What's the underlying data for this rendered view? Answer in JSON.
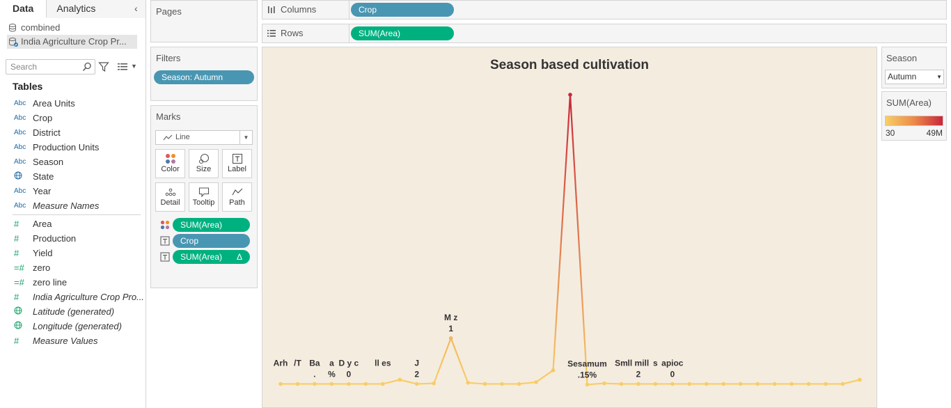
{
  "data_pane": {
    "tabs": [
      {
        "label": "Data",
        "active": true
      },
      {
        "label": "Analytics",
        "active": false
      }
    ],
    "collapse_glyph": "‹",
    "datasources": [
      {
        "label": "combined",
        "icon": "datasource-icon",
        "selected": false
      },
      {
        "label": "India Agriculture Crop Pr...",
        "icon": "datasource-linked-icon",
        "selected": true
      }
    ],
    "search": {
      "placeholder": "Search"
    },
    "tables_heading": "Tables",
    "dimensions": [
      {
        "type": "Abc",
        "label": "Area Units",
        "italic": false
      },
      {
        "type": "Abc",
        "label": "Crop",
        "italic": false
      },
      {
        "type": "Abc",
        "label": "District",
        "italic": false
      },
      {
        "type": "Abc",
        "label": "Production Units",
        "italic": false
      },
      {
        "type": "Abc",
        "label": "Season",
        "italic": false
      },
      {
        "type": "geo",
        "label": "State",
        "italic": false
      },
      {
        "type": "Abc",
        "label": "Year",
        "italic": false
      },
      {
        "type": "Abc",
        "label": "Measure Names",
        "italic": true
      }
    ],
    "measures": [
      {
        "type": "#",
        "label": "Area",
        "italic": false
      },
      {
        "type": "#",
        "label": "Production",
        "italic": false
      },
      {
        "type": "#",
        "label": "Yield",
        "italic": false
      },
      {
        "type": "=#",
        "label": "zero",
        "italic": false
      },
      {
        "type": "=#",
        "label": "zero line",
        "italic": false
      },
      {
        "type": "#",
        "label": "India Agriculture Crop Pro...",
        "italic": true
      },
      {
        "type": "geo",
        "label": "Latitude (generated)",
        "italic": true
      },
      {
        "type": "geo",
        "label": "Longitude (generated)",
        "italic": true
      },
      {
        "type": "#",
        "label": "Measure Values",
        "italic": true
      }
    ]
  },
  "pages_card": {
    "title": "Pages"
  },
  "filters_card": {
    "title": "Filters",
    "pill": "Season: Autumn"
  },
  "marks_card": {
    "title": "Marks",
    "mark_type": "Line",
    "buttons": [
      "Color",
      "Size",
      "Label",
      "Detail",
      "Tooltip",
      "Path"
    ],
    "pills": [
      {
        "icon": "color-dots-icon",
        "label": "SUM(Area)",
        "color": "green",
        "delta": ""
      },
      {
        "icon": "text-label-icon",
        "label": "Crop",
        "color": "blue",
        "delta": ""
      },
      {
        "icon": "text-label-icon",
        "label": "SUM(Area)",
        "color": "green",
        "delta": "Δ"
      }
    ]
  },
  "columns_shelf": {
    "label": "Columns",
    "pill": "Crop"
  },
  "rows_shelf": {
    "label": "Rows",
    "pill": "SUM(Area)"
  },
  "season_legend": {
    "title": "Season",
    "value": "Autumn"
  },
  "color_legend": {
    "title": "SUM(Area)",
    "min_label": "30",
    "max_label": "49M",
    "gradient": [
      "#f7cf66",
      "#ec8a48",
      "#c9273a"
    ]
  },
  "chart_data": {
    "type": "line",
    "title": "Season based cultivation",
    "value_scale": [
      0,
      49
    ],
    "values": [
      0.3,
      0.3,
      0.3,
      0.3,
      0.3,
      0.3,
      0.3,
      1.0,
      0.3,
      0.4,
      8.0,
      0.5,
      0.3,
      0.3,
      0.3,
      0.6,
      2.6,
      49.0,
      0.2,
      0.4,
      0.3,
      0.3,
      0.3,
      0.3,
      0.3,
      0.3,
      0.3,
      0.3,
      0.3,
      0.3,
      0.3,
      0.3,
      0.3,
      0.3,
      1.0
    ],
    "colors": {
      "low": "#f7cf66",
      "mid": "#ec8a48",
      "high": "#c9273a"
    },
    "labels": [
      {
        "index": 0,
        "lines": [
          "Arh",
          ""
        ]
      },
      {
        "index": 1,
        "lines": [
          "/T",
          ""
        ]
      },
      {
        "index": 2,
        "lines": [
          "Ba",
          "."
        ]
      },
      {
        "index": 3,
        "lines": [
          "a",
          "%"
        ]
      },
      {
        "index": 4,
        "lines": [
          "D y c",
          "0"
        ]
      },
      {
        "index": 6,
        "lines": [
          "ll es",
          ""
        ]
      },
      {
        "index": 8,
        "lines": [
          "J",
          "2"
        ]
      },
      {
        "index": 10,
        "lines": [
          "M  z",
          "1"
        ]
      },
      {
        "index": 18,
        "lines": [
          "Sesamum",
          ".15%"
        ]
      },
      {
        "index": 20,
        "lines": [
          "Sm",
          ""
        ]
      },
      {
        "index": 21,
        "lines": [
          "ll mill",
          "2"
        ]
      },
      {
        "index": 22,
        "lines": [
          "s",
          ""
        ]
      },
      {
        "index": 23,
        "lines": [
          "apioc",
          "0"
        ]
      }
    ]
  }
}
